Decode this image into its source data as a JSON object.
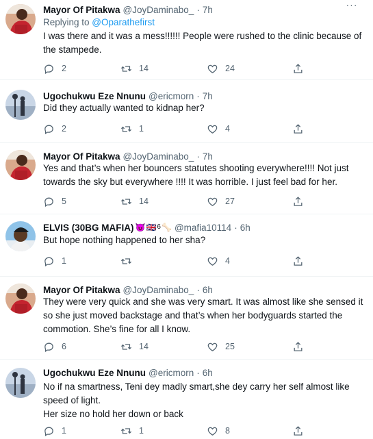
{
  "tweets": [
    {
      "name": "Mayor Of Pitakwa",
      "handle": "@JoyDaminabo_",
      "time": "7h",
      "replying_prefix": "Replying to ",
      "replying_to": "@Oparathefirst",
      "text": [
        "I was there and it was a mess!!!!!! People were rushed to the clinic because of the stampede."
      ],
      "replies": "2",
      "retweets": "14",
      "likes": "24",
      "avatar": "mayor"
    },
    {
      "name": "Ugochukwu Eze Nnunu",
      "handle": "@ericmorn",
      "time": "7h",
      "text": [
        "Did they actually wanted to kidnap her?"
      ],
      "replies": "2",
      "retweets": "1",
      "likes": "4",
      "avatar": "ugochukwu"
    },
    {
      "name": "Mayor Of Pitakwa",
      "handle": "@JoyDaminabo_",
      "time": "7h",
      "text": [
        "Yes and that’s when her bouncers statutes shooting everywhere!!!! Not just towards the sky but everywhere !!!! It was horrible. I just feel bad for her."
      ],
      "replies": "5",
      "retweets": "14",
      "likes": "27",
      "avatar": "mayor"
    },
    {
      "name": "ELVIS (30BG MAFIA)",
      "badges": [
        "",
        "😈",
        "🇬🇧",
        "6",
        "🦴"
      ],
      "handle": "@mafia10114",
      "time": "6h",
      "text": [
        "But hope nothing happened to her sha?"
      ],
      "replies": "1",
      "retweets": "",
      "likes": "4",
      "avatar": "elvis"
    },
    {
      "name": "Mayor Of Pitakwa",
      "handle": "@JoyDaminabo_",
      "time": "6h",
      "text": [
        "They were very quick and she was very smart. It was almost like she sensed it so she just moved backstage and that’s when her bodyguards started the commotion. She’s fine for all I know."
      ],
      "replies": "6",
      "retweets": "14",
      "likes": "25",
      "avatar": "mayor"
    },
    {
      "name": "Ugochukwu Eze Nnunu",
      "handle": "@ericmorn",
      "time": "6h",
      "text": [
        "No if na smartness, Teni dey madly smart,she dey carry her self almost like speed of light.",
        "Her size no hold her down or back"
      ],
      "replies": "1",
      "retweets": "1",
      "likes": "8",
      "avatar": "ugochukwu"
    }
  ],
  "icons": {
    "more": "more-icon",
    "reply": "reply-icon",
    "retweet": "retweet-icon",
    "like": "like-icon",
    "share": "share-icon"
  },
  "colors": {
    "text": "#0f1419",
    "muted": "#536471",
    "link": "#1d9bf0",
    "divider": "#eff3f4"
  }
}
